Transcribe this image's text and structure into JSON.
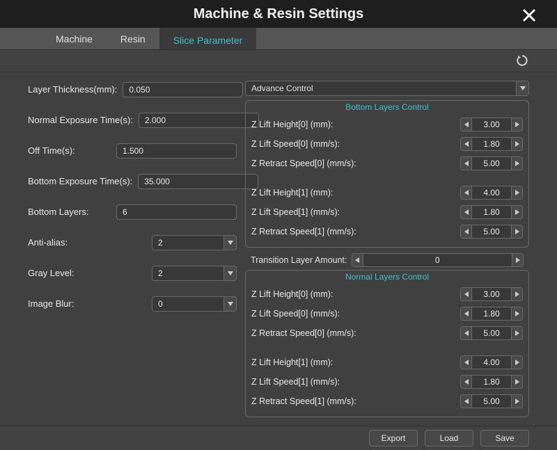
{
  "title": "Machine & Resin Settings",
  "tabs": {
    "machine": "Machine",
    "resin": "Resin",
    "slice": "Slice Parameter"
  },
  "left": {
    "layer_thickness": {
      "label": "Layer Thickness(mm):",
      "value": "0.050"
    },
    "normal_exposure": {
      "label": "Normal Exposure Time(s):",
      "value": "2.000"
    },
    "off_time": {
      "label": "Off Time(s):",
      "value": "1.500"
    },
    "bottom_exposure": {
      "label": "Bottom Exposure Time(s):",
      "value": "35.000"
    },
    "bottom_layers": {
      "label": "Bottom Layers:",
      "value": "6"
    },
    "anti_alias": {
      "label": "Anti-alias:",
      "value": "2"
    },
    "gray_level": {
      "label": "Gray Level:",
      "value": "2"
    },
    "image_blur": {
      "label": "Image Blur:",
      "value": "0"
    }
  },
  "right": {
    "advance_label": "Advance Control",
    "bottom_title": "Bottom Layers Control",
    "normal_title": "Normal Layers Control",
    "transition": {
      "label": "Transition Layer Amount:",
      "value": "0"
    },
    "bottom0": {
      "lift_h": {
        "label": "Z Lift Height[0] (mm):",
        "value": "3.00"
      },
      "lift_s": {
        "label": "Z Lift Speed[0] (mm/s):",
        "value": "1.80"
      },
      "retract_s": {
        "label": "Z Retract Speed[0] (mm/s):",
        "value": "5.00"
      }
    },
    "bottom1": {
      "lift_h": {
        "label": "Z Lift Height[1] (mm):",
        "value": "4.00"
      },
      "lift_s": {
        "label": "Z Lift Speed[1] (mm/s):",
        "value": "1.80"
      },
      "retract_s": {
        "label": "Z Retract Speed[1] (mm/s):",
        "value": "5.00"
      }
    },
    "normal0": {
      "lift_h": {
        "label": "Z Lift Height[0] (mm):",
        "value": "3.00"
      },
      "lift_s": {
        "label": "Z Lift Speed[0] (mm/s):",
        "value": "1.80"
      },
      "retract_s": {
        "label": "Z Retract Speed[0] (mm/s):",
        "value": "5.00"
      }
    },
    "normal1": {
      "lift_h": {
        "label": "Z Lift Height[1] (mm):",
        "value": "4.00"
      },
      "lift_s": {
        "label": "Z Lift Speed[1] (mm/s):",
        "value": "1.80"
      },
      "retract_s": {
        "label": "Z Retract Speed[1] (mm/s):",
        "value": "5.00"
      }
    }
  },
  "footer": {
    "export": "Export",
    "load": "Load",
    "save": "Save"
  }
}
